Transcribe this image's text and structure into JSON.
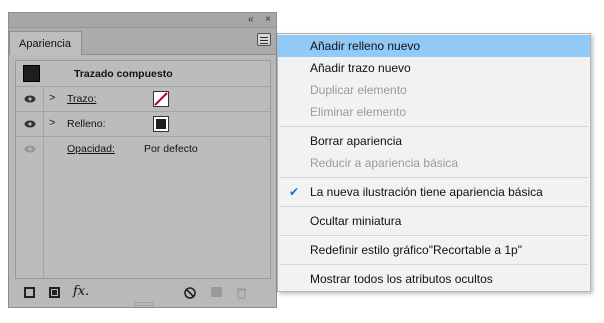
{
  "panel": {
    "collapse_glyph": "«",
    "close_glyph": "×",
    "tab_label": "Apariencia",
    "object_label": "Trazado compuesto",
    "rows": [
      {
        "label": "Trazo:",
        "visible": true,
        "expandable": true,
        "swatch": "stroke-none"
      },
      {
        "label": "Relleno:",
        "visible": true,
        "expandable": true,
        "swatch": "fill-black"
      },
      {
        "label": "Opacidad:",
        "value": "Por defecto",
        "visible": false,
        "expandable": false
      }
    ],
    "bottom": {
      "fx_label": "fx."
    }
  },
  "menu": {
    "items": [
      {
        "label": "Añadir relleno nuevo",
        "state": "highlighted"
      },
      {
        "label": "Añadir trazo nuevo",
        "state": "enabled"
      },
      {
        "label": "Duplicar elemento",
        "state": "disabled"
      },
      {
        "label": "Eliminar elemento",
        "state": "disabled"
      },
      {
        "label": "Borrar apariencia",
        "state": "enabled"
      },
      {
        "label": "Reducir a apariencia básica",
        "state": "disabled"
      },
      {
        "label": "La nueva ilustración tiene apariencia básica",
        "state": "checked"
      },
      {
        "label": "Ocultar miniatura",
        "state": "enabled"
      },
      {
        "label": "Redefinir estilo gráfico\"Recortable a 1p\"",
        "state": "enabled"
      },
      {
        "label": "Mostrar todos los atributos ocultos",
        "state": "enabled"
      }
    ]
  },
  "colors": {
    "highlight": "#91c9f7",
    "check": "#1a73c7",
    "stroke_slash": "#c0001a"
  }
}
